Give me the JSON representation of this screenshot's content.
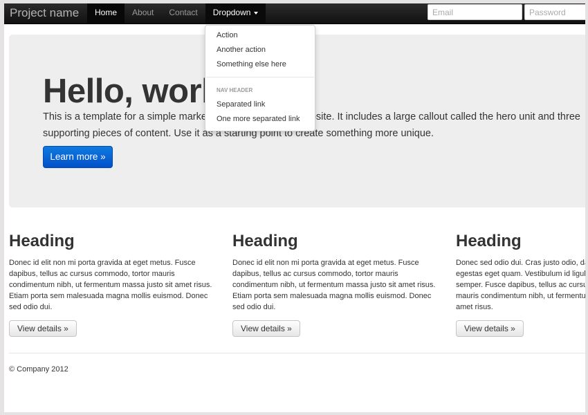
{
  "navbar": {
    "brand": "Project name",
    "items": [
      {
        "label": "Home"
      },
      {
        "label": "About"
      },
      {
        "label": "Contact"
      },
      {
        "label": "Dropdown"
      }
    ],
    "email_placeholder": "Email",
    "password_placeholder": "Password"
  },
  "dropdown": {
    "items": [
      "Action",
      "Another action",
      "Something else here"
    ],
    "header": "NAV HEADER",
    "separated_items": [
      "Separated link",
      "One more separated link"
    ]
  },
  "hero": {
    "title": "Hello, world!",
    "text": "This is a template for a simple marketing or informational website. It includes a large callout called the hero unit and three supporting pieces of content. Use it as a starting point to create something more unique.",
    "button": "Learn more »"
  },
  "columns": [
    {
      "heading": "Heading",
      "text": "Donec id elit non mi porta gravida at eget metus. Fusce dapibus, tellus ac cursus commodo, tortor mauris condimentum nibh, ut fermentum massa justo sit amet risus. Etiam porta sem malesuada magna mollis euismod. Donec sed odio dui.",
      "button": "View details »"
    },
    {
      "heading": "Heading",
      "text": "Donec id elit non mi porta gravida at eget metus. Fusce dapibus, tellus ac cursus commodo, tortor mauris condimentum nibh, ut fermentum massa justo sit amet risus. Etiam porta sem malesuada magna mollis euismod. Donec sed odio dui.",
      "button": "View details »"
    },
    {
      "heading": "Heading",
      "text": "Donec sed odio dui. Cras justo odio, dapibus ac facilisis in, egestas eget quam. Vestibulum id ligula porta felis euismod semper. Fusce dapibus, tellus ac cursus commodo, tortor mauris condimentum nibh, ut fermentum massa justo sit amet risus.",
      "button": "View details »"
    }
  ],
  "footer": {
    "text": "© Company 2012"
  },
  "colors": {
    "navbar": "#1b1b1b",
    "primary": "#0866d6",
    "hero_bg": "#eeeeee"
  }
}
